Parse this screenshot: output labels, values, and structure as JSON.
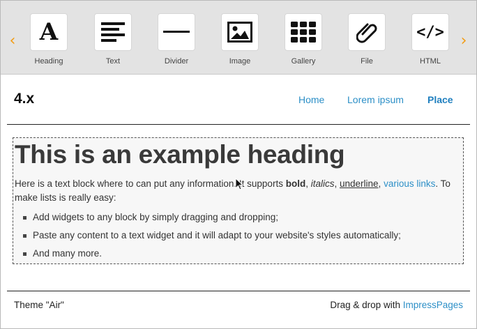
{
  "toolbar": {
    "prev_arrow": "‹",
    "next_arrow": "›",
    "widgets": [
      {
        "label": "Heading",
        "icon": "heading-icon",
        "glyph": "A"
      },
      {
        "label": "Text",
        "icon": "text-icon"
      },
      {
        "label": "Divider",
        "icon": "divider-icon"
      },
      {
        "label": "Image",
        "icon": "image-icon"
      },
      {
        "label": "Gallery",
        "icon": "gallery-icon"
      },
      {
        "label": "File",
        "icon": "paperclip-icon"
      },
      {
        "label": "HTML",
        "icon": "code-icon",
        "glyph": "</>"
      }
    ]
  },
  "site": {
    "logo": "4.x",
    "nav": [
      "Home",
      "Lorem ipsum",
      "Place"
    ],
    "active_nav": "Place"
  },
  "content": {
    "heading": "This is an example heading",
    "para": {
      "t1": "Here is a text block where to can put any information. It supports ",
      "bold": "bold",
      "sep1": ", ",
      "italic": "italics",
      "sep2": ", ",
      "underline": "underline",
      "sep3": ", ",
      "link": "various links",
      "t2": ". To make lists is really easy:"
    },
    "list": [
      "Add widgets to any block by simply dragging and dropping;",
      "Paste any content to a text widget and it will adapt to your website's styles automatically;",
      "And many more."
    ]
  },
  "footer": {
    "theme": "Theme \"Air\"",
    "credit_prefix": "Drag & drop with ",
    "credit_link": "ImpressPages"
  },
  "colors": {
    "accent_orange": "#f39c12",
    "link_blue": "#2c8fc7",
    "toolbar_bg": "#e3e3e3"
  }
}
